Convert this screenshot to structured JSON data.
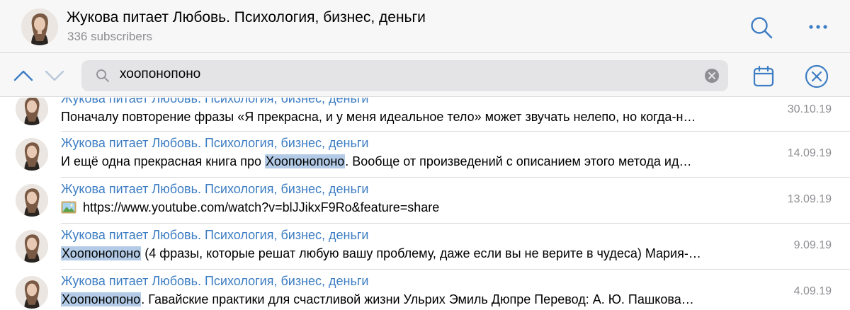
{
  "channel": {
    "title": "Жукова питает Любовь. Психология, бизнес, деньги",
    "subscribers": "336 subscribers"
  },
  "search": {
    "query": "хоопонопоно"
  },
  "results": [
    {
      "source": "Жукова питает Любовь. Психология, бизнес, деньги",
      "pre": "",
      "highlight": "",
      "post": "Поначалу повторение фразы «Я прекрасна, и у меня идеальное тело» может звучать нелепо, но когда-н…",
      "date": "30.10.19"
    },
    {
      "source": "Жукова питает Любовь. Психология, бизнес, деньги",
      "pre": "И ещё одна прекрасная книга про ",
      "highlight": "Хоопонопоно",
      "post": ".  Вообще от произведений с описанием этого метода ид…",
      "date": "14.09.19"
    },
    {
      "source": "Жукова питает Любовь. Психология, бизнес, деньги",
      "pre": "",
      "highlight": "",
      "post": "https://www.youtube.com/watch?v=blJJikxF9Ro&feature=share",
      "date": "13.09.19",
      "has_image_icon": true
    },
    {
      "source": "Жукова питает Любовь. Психология, бизнес, деньги",
      "pre": "",
      "highlight": "Хоопонопоно",
      "post": " (4 фразы, которые решат любую вашу проблему, даже если вы не верите в чудеса)  Мария-…",
      "date": "9.09.19"
    },
    {
      "source": "Жукова питает Любовь. Психология, бизнес, деньги",
      "pre": "",
      "highlight": "Хоопонопоно",
      "post": ". Гавайские практики для счастливой жизни Ульрих Эмиль Дюпре  Перевод: А. Ю. Пашкова…",
      "date": "4.09.19"
    }
  ],
  "colors": {
    "accent": "#3d7dc3",
    "highlight": "#b3cbe6",
    "muted": "#8e8e93"
  }
}
